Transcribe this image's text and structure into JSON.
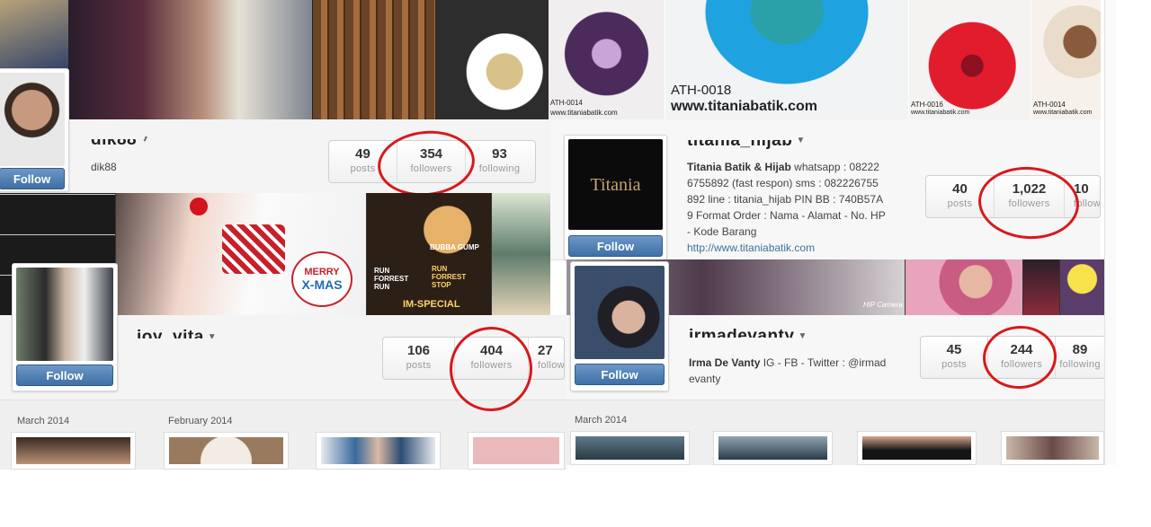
{
  "profiles": [
    {
      "username": "dik88",
      "fullname": "dik88",
      "follow_label": "Follow",
      "stats": [
        {
          "num": "49",
          "lbl": "posts"
        },
        {
          "num": "354",
          "lbl": "followers"
        },
        {
          "num": "93",
          "lbl": "following"
        }
      ]
    },
    {
      "username": "joy_vita",
      "follow_label": "Follow",
      "stats": [
        {
          "num": "106",
          "lbl": "posts"
        },
        {
          "num": "404",
          "lbl": "followers"
        },
        {
          "num": "27",
          "lbl": "following"
        }
      ],
      "months": [
        "March 2014",
        "February 2014"
      ]
    },
    {
      "username": "titania_hijab",
      "follow_label": "Follow",
      "avatar_text": "Titania",
      "bio_name": "Titania Batik & Hijab",
      "bio_lines": [
        " whatsapp : 08222",
        "6755892 (fast respon) sms : 082226755",
        "892 line : titania_hijab PIN BB : 740B57A",
        "9 Format Order : Nama - Alamat - No. HP",
        "- Kode Barang"
      ],
      "website": "http://www.titaniabatik.com",
      "cover_captions": [
        "ATH-0014",
        "www.titaniabatik.com",
        "ATH-0018",
        "www.titaniabatik.com",
        "ATH-0016",
        "www.titaniabatik.com",
        "ATH-0014",
        "www.titaniabatik.com"
      ],
      "stats": [
        {
          "num": "40",
          "lbl": "posts"
        },
        {
          "num": "1,022",
          "lbl": "followers"
        },
        {
          "num": "10",
          "lbl": "following"
        }
      ]
    },
    {
      "username": "irmadevanty",
      "follow_label": "Follow",
      "bio_name": "Irma De Vanty",
      "bio_lines": [
        " IG - FB - Twitter : @irmad",
        "evanty"
      ],
      "stats": [
        {
          "num": "45",
          "lbl": "posts"
        },
        {
          "num": "244",
          "lbl": "followers"
        },
        {
          "num": "89",
          "lbl": "following"
        }
      ],
      "months": [
        "March 2014"
      ]
    }
  ],
  "cover_texts": {
    "merry": "MERRY",
    "xmas": "X-MAS",
    "run1": "RUN FORREST RUN",
    "run2": "RUN FORREST STOP",
    "bubba": "BUBBA GUMP",
    "special": "IM-SPECIAL",
    "hip": "HIP Camera"
  },
  "colors": {
    "follow_button": "#4a78ad",
    "annotation_circle": "#d7191c",
    "link": "#3f729b"
  }
}
